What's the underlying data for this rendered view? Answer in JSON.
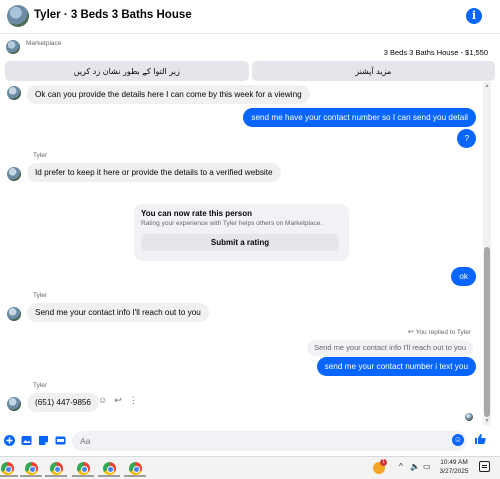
{
  "header": {
    "title": "Tyler · 3 Beds 3 Baths House",
    "info_icon": "info-icon",
    "info_glyph": "i",
    "accent_color": "#0866ff"
  },
  "listing": {
    "source_label": "Marketplace",
    "title_price": "3 Beds 3 Baths House - $1,550"
  },
  "quick_replies": [
    {
      "label": "زیر التوا کے بطور نشان زد کریں"
    },
    {
      "label": "مزید آپشنز"
    }
  ],
  "messages": [
    {
      "from": "other",
      "text": "Ok can you provide the details here I can come by this week for a viewing"
    },
    {
      "from": "me",
      "text": "send me have your contact number so I can send you detail"
    },
    {
      "from": "me",
      "text": "?"
    },
    {
      "from": "other",
      "sender": "Tyler",
      "text": "Id prefer to keep it here or provide the details to a verified website"
    },
    {
      "from": "me",
      "text": "ok"
    },
    {
      "from": "other",
      "sender": "Tyler",
      "text": "Send me your contact info I'll reach out to you"
    },
    {
      "from": "me",
      "text": "send me your contact number i text you"
    },
    {
      "from": "other",
      "sender": "Tyler",
      "text": "(651) 447-9856"
    }
  ],
  "rating_card": {
    "title": "You can now rate this person",
    "subtitle": "Rating your experience with Tyler helps others on Marketplace.",
    "button": "Submit a rating"
  },
  "reply_context": {
    "label": "You replied to Tyler",
    "quoted": "Send me your contact info I'll reach out to you"
  },
  "composer": {
    "placeholder": "Aa"
  },
  "taskbar": {
    "time": "10:49 AM",
    "date": "3/27/2025",
    "weather_badge": "1"
  }
}
